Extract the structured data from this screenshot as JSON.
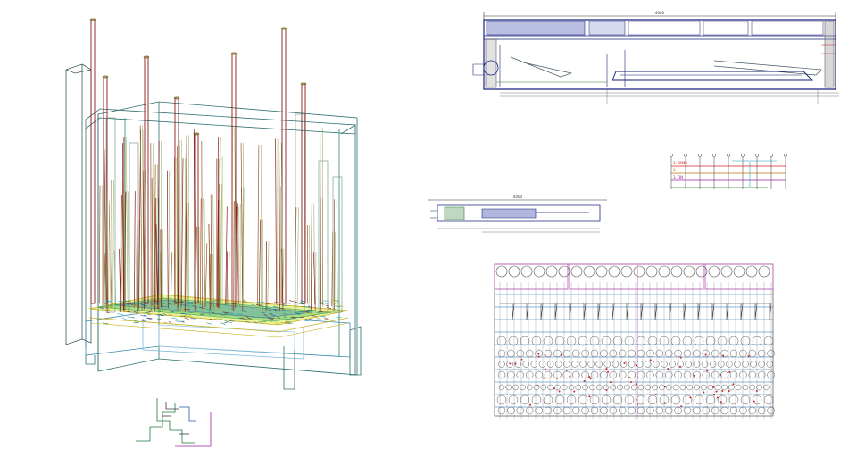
{
  "drawing": {
    "section_dimension": "4000",
    "mini_section_dimension": "4000",
    "legend_rows": [
      "1. DN80",
      "2.",
      "3. DN"
    ],
    "legend_colors": [
      "#d42020",
      "#c07000",
      "#a020a0"
    ],
    "pipe_colors": [
      "#8b1a1a",
      "#a0522d",
      "#6b8e23",
      "#2e8b57",
      "#1e5aa8"
    ],
    "frame_color": "#2f6f6f",
    "plan_header_color": "#c060c0"
  }
}
